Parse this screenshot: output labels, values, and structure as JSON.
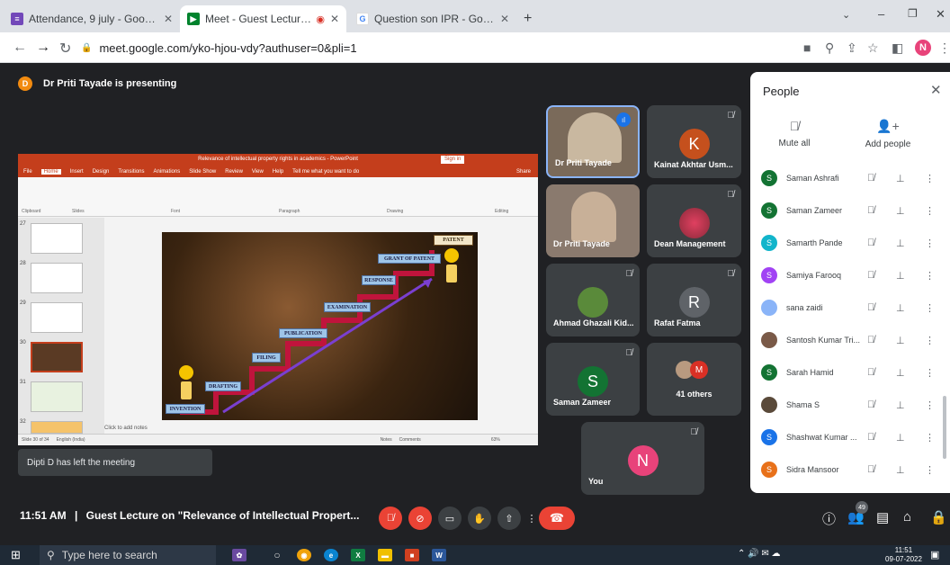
{
  "browser": {
    "tabs": [
      {
        "title": "Attendance, 9 july - Google Form",
        "icon": "forms-icon",
        "color": "#7248b9"
      },
      {
        "title": "Meet - Guest Lecture on \"Re",
        "icon": "meet-icon",
        "color": "#00832d"
      },
      {
        "title": "Question son IPR - Google Search",
        "icon": "google-icon",
        "color": "#4285f4"
      }
    ],
    "url": "meet.google.com/yko-hjou-vdy?authuser=0&pli=1",
    "profile_initial": "N"
  },
  "meet": {
    "presenting_initial": "D",
    "presenting_text": "Dr Priti Tayade is presenting",
    "toast": "Dipti D has left the meeting",
    "meeting_time": "11:51 AM",
    "meeting_separator": "|",
    "meeting_title": "Guest Lecture on \"Relevance of Intellectual Propert...",
    "people_badge": "49"
  },
  "presentation": {
    "window_title": "Relevance of intellectual property rights in academics - PowerPoint",
    "sign_in": "Sign in",
    "menu": [
      "File",
      "Home",
      "Insert",
      "Design",
      "Transitions",
      "Animations",
      "Slide Show",
      "Review",
      "View",
      "Help",
      "Tell me what you want to do"
    ],
    "share": "Share",
    "ribbon_groups": [
      "Clipboard",
      "Slides",
      "Font",
      "Paragraph",
      "Drawing",
      "Editing"
    ],
    "thumb_numbers": [
      "27",
      "28",
      "29",
      "30",
      "31",
      "32"
    ],
    "notes": "Click to add notes",
    "status_left": "Slide 30 of 34",
    "status_lang": "English (India)",
    "status_notes": "Notes",
    "status_comments": "Comments",
    "zoom": "63%",
    "slide_steps": [
      "INVENTION",
      "DRAFTING",
      "FILING",
      "PUBLICATION",
      "EXAMINATION",
      "RESPONSE",
      "GRANT OF PATENT"
    ],
    "slide_top": "PATENT"
  },
  "tiles": [
    {
      "name": "Dr Priti Tayade",
      "type": "video"
    },
    {
      "name": "Kainat Akhtar Usm...",
      "initial": "K",
      "color": "#c5501d"
    },
    {
      "name": "Dr Priti Tayade",
      "type": "video"
    },
    {
      "name": "Dean Management",
      "type": "image"
    },
    {
      "name": "Ahmad Ghazali Kid...",
      "type": "image"
    },
    {
      "name": "Rafat Fatma",
      "initial": "R",
      "color": "#5f6368"
    },
    {
      "name": "Saman Zameer",
      "initial": "S",
      "color": "#137333"
    },
    {
      "name": "41 others",
      "initial": "M",
      "color": "#d93025"
    },
    {
      "name": "You",
      "initial": "N",
      "color": "#e8437a"
    }
  ],
  "people": {
    "title": "People",
    "mute_all": "Mute all",
    "add_people": "Add people",
    "list": [
      {
        "initial": "S",
        "name": "Saman Ashrafi",
        "color": "#137333"
      },
      {
        "initial": "S",
        "name": "Saman Zameer",
        "color": "#137333"
      },
      {
        "initial": "S",
        "name": "Samarth Pande",
        "color": "#12b5cb"
      },
      {
        "initial": "S",
        "name": "Samiya Farooq",
        "color": "#a142f4"
      },
      {
        "initial": "",
        "name": "sana zaidi",
        "color": "#8ab4f8"
      },
      {
        "initial": "",
        "name": "Santosh Kumar Tri...",
        "color": "#7a5a48"
      },
      {
        "initial": "S",
        "name": "Sarah Hamid",
        "color": "#137333"
      },
      {
        "initial": "",
        "name": "Shama S",
        "color": "#5a4a3a"
      },
      {
        "initial": "S",
        "name": "Shashwat Kumar ...",
        "color": "#1a73e8"
      },
      {
        "initial": "S",
        "name": "Sidra Mansoor",
        "color": "#e8711a"
      }
    ]
  },
  "taskbar": {
    "search_placeholder": "Type here to search",
    "time": "11:51",
    "date": "09-07-2022"
  }
}
